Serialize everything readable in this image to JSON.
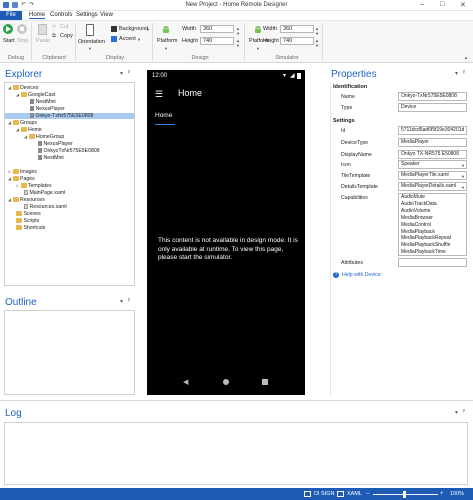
{
  "window": {
    "title": "New Project - Home Remote Designer"
  },
  "menu": {
    "file": "File",
    "items": [
      "Home",
      "Controls",
      "Settings",
      "View"
    ]
  },
  "ribbon": {
    "debug": {
      "start": "Start",
      "stop": "Stop",
      "label": "Debug"
    },
    "clipboard": {
      "paste": "Paste",
      "cut": "Cut",
      "copy": "Copy",
      "label": "Clipboard"
    },
    "display": {
      "orientation": "Orientation",
      "background": "Background",
      "accent": "Accent",
      "label": "Display"
    },
    "design": {
      "platform": "Platform",
      "width_label": "Width",
      "width_value": "360",
      "height_label": "Height",
      "height_value": "740",
      "label": "Design"
    },
    "simulator": {
      "platform": "Platform",
      "width_label": "Width",
      "width_value": "360",
      "height_label": "Height",
      "height_value": "740",
      "label": "Simulator"
    }
  },
  "explorer": {
    "title": "Explorer",
    "items": [
      "Devices",
      "GoogleCast",
      "NestMini",
      "NexusPlayer",
      "Onkyo-TxNr575E5E0808",
      "Groups",
      "Home",
      "HomeGroup",
      "NexusPlayer",
      "OnkyoTxNr575E5E0808",
      "NestMini",
      "Images",
      "Pages",
      "Templates",
      "MainPage.xaml",
      "Resources",
      "Resources.xaml",
      "Scenes",
      "Scripts",
      "Shortcuts"
    ]
  },
  "outline": {
    "title": "Outline"
  },
  "log": {
    "title": "Log"
  },
  "phone": {
    "time": "12:00",
    "title": "Home",
    "tab": "Home",
    "message": "This content is not available in design mode. It is only available at runtime. To view this page, please start the simulator."
  },
  "properties": {
    "title": "Properties",
    "identification": "Identification",
    "name_label": "Name",
    "name_value": "Onkyo-TxNr575E5E0808",
    "type_label": "Type",
    "type_value": "Device",
    "settings": "Settings",
    "id_label": "Id",
    "id_value": "5711dcd5ad6f5f19e304201d",
    "devicetype_label": "DeviceType",
    "devicetype_value": "MediaPlayer",
    "displayname_label": "DisplayName",
    "displayname_value": "Onkyo TX-NR575 E50808",
    "icon_label": "Icon",
    "icon_value": "Speaker",
    "tiletemplate_label": "TileTemplate",
    "tiletemplate_value": "MediaPlayerTile.xaml",
    "detailstemplate_label": "DetailsTemplate",
    "detailstemplate_value": "MediaPlayerDetails.xaml",
    "capabilities_label": "Capabilities",
    "capabilities": [
      "AudioMute",
      "AudioTrackData",
      "AudioVolume",
      "MediaBrowser",
      "MediaControl",
      "MediaPlayback",
      "MediaPlaybackRepeat",
      "MediaPlaybackShuffle",
      "MediaPlaybackTime"
    ],
    "attributes_label": "Attributes",
    "help": "Help with Device"
  },
  "status": {
    "dpi": "DI SIGN",
    "xaml": "XAML",
    "zoom": "100%"
  },
  "colors": {
    "accent": "#1e5bb5",
    "title_blue": "#1e62c9",
    "android_green": "#78c257"
  }
}
